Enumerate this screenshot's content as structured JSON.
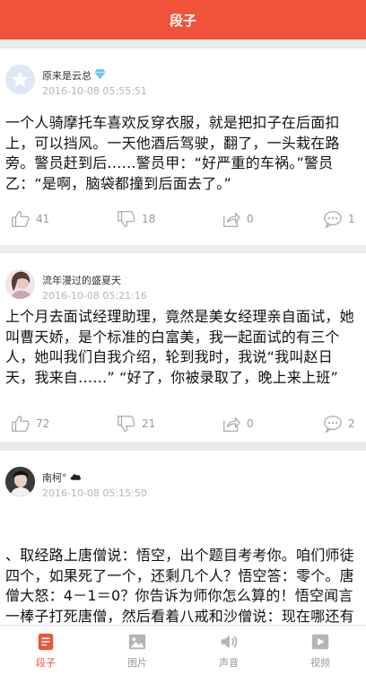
{
  "header": {
    "title": "段子"
  },
  "posts": [
    {
      "user": "原来是云总",
      "time": "2016-10-08 05:55:51",
      "text": "一个人骑摩托车喜欢反穿衣服，就是把扣子在后面扣上，可以挡风。一天他酒后驾驶，翻了，一头栽在路旁。警员赶到后……警员甲：“好严重的车祸。”警员乙：“是啊，脑袋都撞到后面去了。”",
      "likes": "41",
      "dislikes": "18",
      "shares": "0",
      "comments": "1"
    },
    {
      "user": "流年漫过的盛夏天",
      "time": "2016-10-08 05:21:16",
      "text": "上个月去面试经理助理，竟然是美女经理亲自面试，她叫曹天娇，是个标准的白富美，我一起面试的有三个人，她叫我们自我介绍，轮到我时，我说“我叫赵日天，我来自……” “好了，你被录取了，晚上来上班”",
      "likes": "72",
      "dislikes": "21",
      "shares": "0",
      "comments": "2"
    },
    {
      "user": "南柯° ",
      "time": "2016-10-08 05:15:50",
      "text": "、取经路上唐僧说：悟空，出个题目考考你。咱们师徒四个，如果死了一个，还剩几个人？悟空答：零个。唐僧大怒：4－1＝0？你告诉为师你怎么算的！悟空闻言一棒子打死唐僧，然后看着八戒和沙僧说：现在哪还有人啊！",
      "likes": "",
      "dislikes": "",
      "shares": "",
      "comments": ""
    }
  ],
  "tabs": [
    {
      "label": "段子",
      "icon": "jokes-icon"
    },
    {
      "label": "图片",
      "icon": "picture-icon"
    },
    {
      "label": "声音",
      "icon": "speaker-icon"
    },
    {
      "label": "视频",
      "icon": "video-icon"
    }
  ],
  "colors": {
    "accent": "#f0533a",
    "muted": "#999999"
  }
}
